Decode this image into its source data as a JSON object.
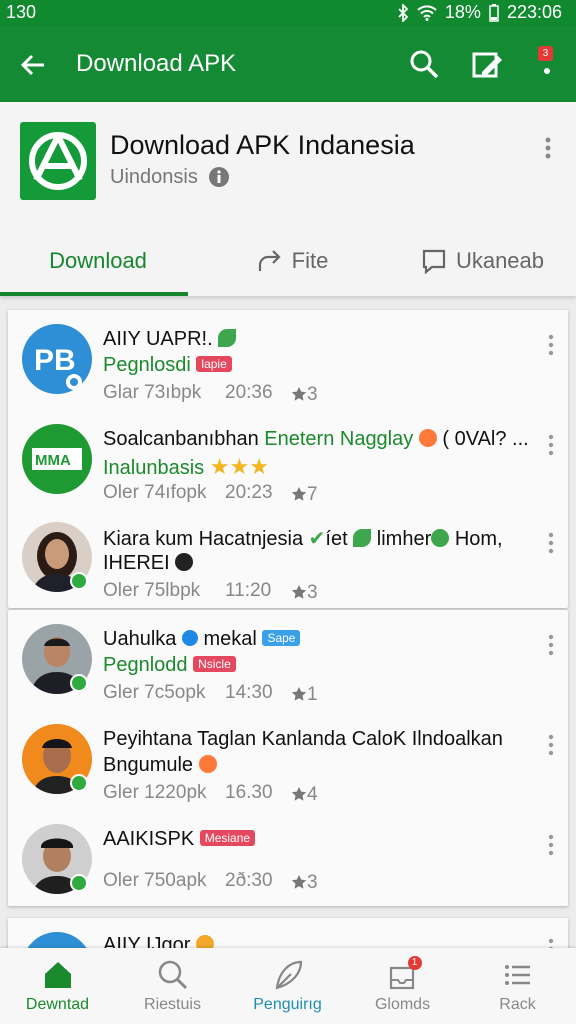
{
  "status_bar": {
    "time": "130",
    "battery": "18%",
    "clock": "223:06"
  },
  "app_bar": {
    "title": "Download APK",
    "notif_badge": "3"
  },
  "header": {
    "app_name": "Download APK Indanesia",
    "developer": "Uindonsis",
    "tabs": [
      {
        "label": "Download",
        "icon": "download-tab-icon"
      },
      {
        "label": "Fite",
        "icon": "share-icon"
      },
      {
        "label": "Ukaneab",
        "icon": "comment-icon"
      }
    ]
  },
  "feed": [
    {
      "line1": "AIIY UAPR!.",
      "line2": "Pegnlosdi",
      "chip": "lapie",
      "chip_color": "red",
      "meta": "Glar 73ıbpk",
      "time": "20:36",
      "stars": "3"
    },
    {
      "line1": "Soalcanbanıbhan",
      "line1_green": "Enetern Nagglay",
      "line1_tail": "( 0VAl?  ...",
      "line2": "Inalunbasis",
      "meta": "Oler 74ıfopk",
      "time": "20:23",
      "stars": "7"
    },
    {
      "line1": "Kiara kum Hacatnjesia",
      "line1_tail": "íet",
      "line1_tail2": "limher",
      "line1_tail3": "Hom,",
      "line2": "IHEREI",
      "meta": "Oler 75lbpk",
      "time": "11:20",
      "stars": "3"
    },
    {
      "line1": "Uahulka",
      "line1_tail": "mekal",
      "chip": "Sape",
      "chip_color": "blue",
      "line2": "Pegnlodd",
      "chip2": "Nsicle",
      "meta": "Gler 7c5opk",
      "time": "14:30",
      "stars": "1"
    },
    {
      "line1": "Peyihtana Taglan Kanlanda CaloK Ilndoalkan",
      "line2": "Bngumule",
      "meta": "Gler 1220pk",
      "time": "16.30",
      "stars": "4"
    },
    {
      "line1": "AAIKISPK",
      "chip": "Mesiane",
      "chip_color": "red",
      "meta": "Oler 750apk",
      "time": "2ð:30",
      "stars": "3"
    },
    {
      "line1": "AIIY IJgor"
    }
  ],
  "bottom_nav": [
    {
      "label": "Dewntad",
      "icon": "home-icon"
    },
    {
      "label": "Riestuis",
      "icon": "search-icon"
    },
    {
      "label": "Penguirıg",
      "icon": "feather-icon"
    },
    {
      "label": "Glomds",
      "icon": "inbox-icon",
      "badge": "1"
    },
    {
      "label": "Rack",
      "icon": "list-icon"
    }
  ]
}
